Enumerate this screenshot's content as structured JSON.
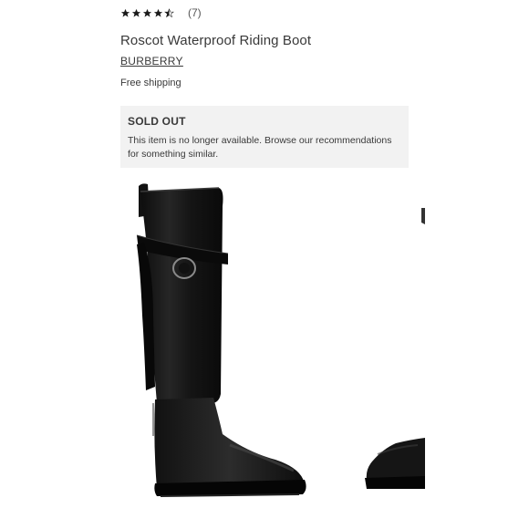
{
  "rating": {
    "value": 4.5,
    "max": 5,
    "count_label": "(7)",
    "star_color": "#1a1a1a"
  },
  "product": {
    "title": "Roscot Waterproof Riding Boot",
    "brand": "BURBERRY",
    "shipping": "Free shipping"
  },
  "notice": {
    "title": "SOLD OUT",
    "message": "This item is no longer available. Browse our recommendations for something similar.",
    "background": "#f2f2f2"
  },
  "images": {
    "main": "black-riding-boot-side-view",
    "next": "black-riding-boot-partial"
  }
}
